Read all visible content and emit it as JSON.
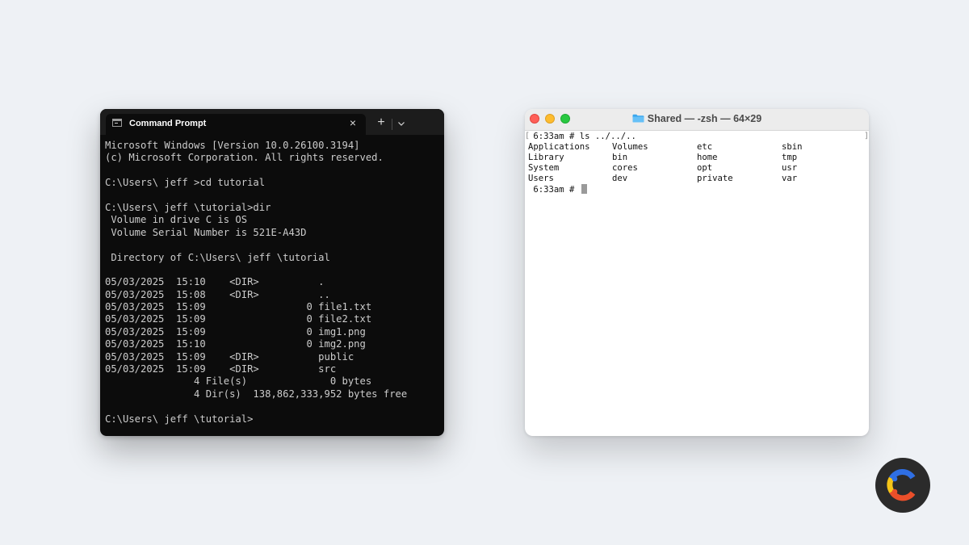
{
  "cmd": {
    "tab_title": "Command Prompt",
    "tab_close_icon": "×",
    "new_tab_icon": "+",
    "lines": [
      "Microsoft Windows [Version 10.0.26100.3194]",
      "(c) Microsoft Corporation. All rights reserved.",
      "",
      "C:\\Users\\ jeff >cd tutorial",
      "",
      "C:\\Users\\ jeff \\tutorial>dir",
      " Volume in drive C is OS",
      " Volume Serial Number is 521E-A43D",
      "",
      " Directory of C:\\Users\\ jeff \\tutorial",
      "",
      "05/03/2025  15:10    <DIR>          .",
      "05/03/2025  15:08    <DIR>          ..",
      "05/03/2025  15:09                 0 file1.txt",
      "05/03/2025  15:09                 0 file2.txt",
      "05/03/2025  15:09                 0 img1.png",
      "05/03/2025  15:10                 0 img2.png",
      "05/03/2025  15:09    <DIR>          public",
      "05/03/2025  15:09    <DIR>          src",
      "               4 File(s)              0 bytes",
      "               4 Dir(s)  138,862,333,952 bytes free",
      "",
      "C:\\Users\\ jeff \\tutorial>"
    ]
  },
  "terminal": {
    "title": "Shared — -zsh — 64×29",
    "command_line": " 6:33am # ls ../../..",
    "listing": [
      [
        "Applications",
        "Volumes",
        "etc",
        "sbin"
      ],
      [
        "Library",
        "bin",
        "home",
        "tmp"
      ],
      [
        "System",
        "cores",
        "opt",
        "usr"
      ],
      [
        "Users",
        "dev",
        "private",
        "var"
      ]
    ],
    "prompt": " 6:33am # "
  },
  "colors": {
    "cmd_bg": "#0c0c0c",
    "cmd_text": "#cccccc",
    "terminal_bg": "#ffffff",
    "traffic_red": "#ff5f57",
    "traffic_yellow": "#febc2e",
    "traffic_green": "#28c840"
  }
}
